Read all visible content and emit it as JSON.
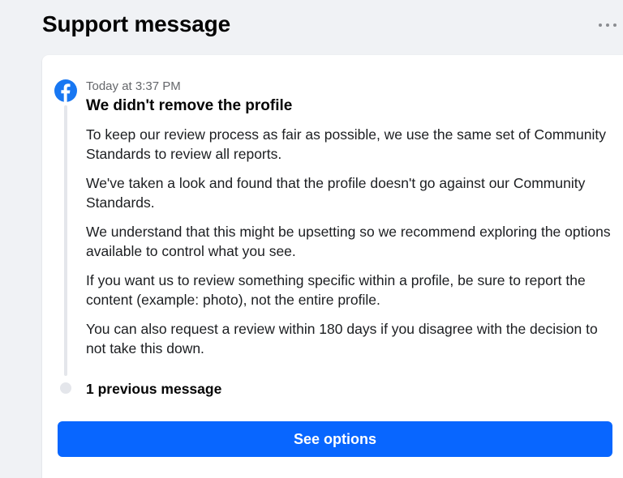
{
  "header": {
    "title": "Support message",
    "more_icon": "more-horizontal-icon"
  },
  "message": {
    "sender_icon": "facebook-logo-icon",
    "brand_color": "#1877f2",
    "timestamp": "Today at 3:37 PM",
    "title": "We didn't remove the profile",
    "paragraphs": [
      "To keep our review process as fair as possible, we use the same set of Community Standards to review all reports.",
      "We've taken a look and found that the profile doesn't go against our Community Standards.",
      "We understand that this might be upsetting so we recommend exploring the options available to control what you see.",
      "If you want us to review something specific within a profile, be sure to report the content (example: photo), not the entire profile.",
      "You can also request a review within 180 days if you disagree with the decision to not take this down."
    ]
  },
  "thread": {
    "previous_label": "1 previous message"
  },
  "actions": {
    "primary_label": "See options",
    "primary_color": "#0866ff"
  }
}
